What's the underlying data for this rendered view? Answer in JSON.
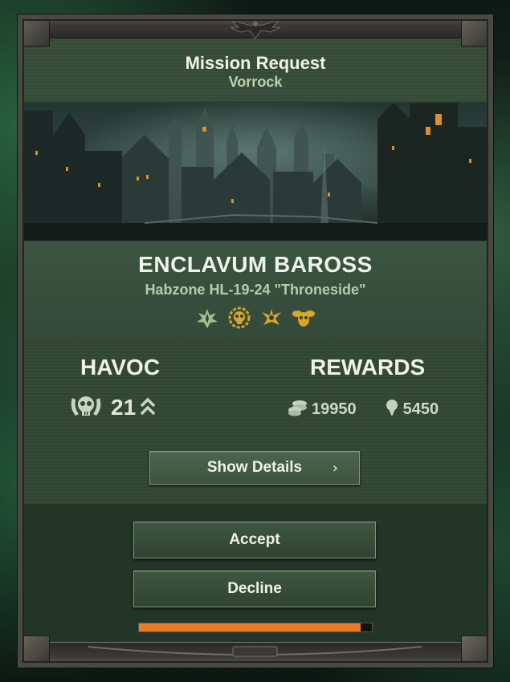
{
  "header": {
    "title": "Mission Request",
    "subtitle": "Vorrock"
  },
  "mission": {
    "location": "ENCLAVUM BAROSS",
    "zone": "Habzone HL-19-24 \"Throneside\"",
    "modifier_icons": [
      "weakened-zone-icon",
      "daemon-skull-icon",
      "winged-sigil-icon",
      "nurgle-fly-icon"
    ]
  },
  "havoc": {
    "heading": "HAVOC",
    "icon": "skull-laurel-icon",
    "value": "21",
    "rank_icon": "double-chevron-up-icon"
  },
  "rewards": {
    "heading": "REWARDS",
    "items": [
      {
        "icon": "coins-icon",
        "value": "19950"
      },
      {
        "icon": "plasteel-icon",
        "value": "5450"
      }
    ]
  },
  "buttons": {
    "details": "Show Details",
    "details_chevron": "›",
    "accept": "Accept",
    "decline": "Decline"
  },
  "timer": {
    "progress": 0.95,
    "color": "#e97b28"
  },
  "colors": {
    "panel": "#2d4230",
    "accent_gold": "#d9a52a",
    "icon_green": "#9fbf97"
  }
}
